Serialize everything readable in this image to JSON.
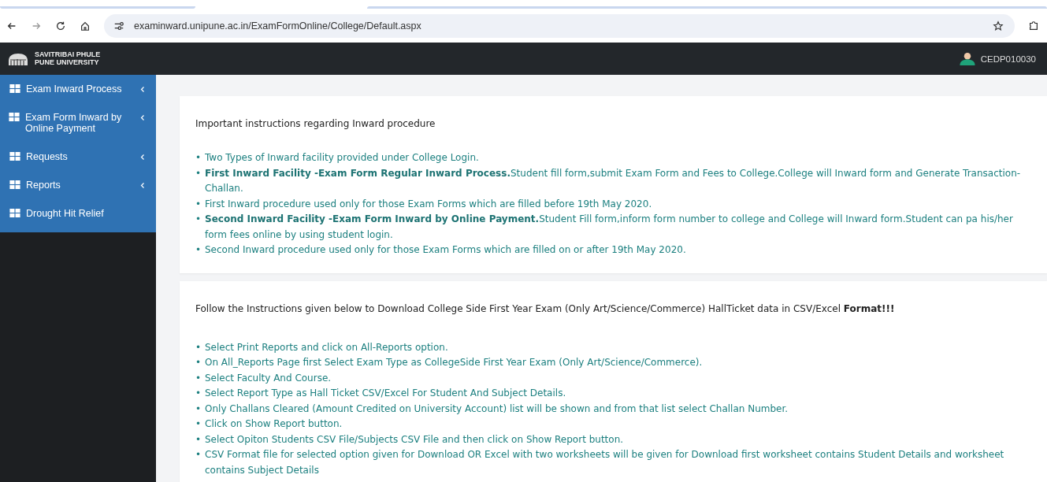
{
  "browser": {
    "url": "examinward.unipune.ac.in/ExamFormOnline/College/Default.aspx"
  },
  "header": {
    "logo_text": [
      "SAVITRIBAI PHULE",
      "PUNE UNIVERSITY"
    ],
    "user": "CEDP010030"
  },
  "sidebar": {
    "items": [
      {
        "label": "Exam Inward Process",
        "has_submenu": true
      },
      {
        "label": "Exam Form Inward by Online Payment",
        "has_submenu": true
      },
      {
        "label": "Requests",
        "has_submenu": true
      },
      {
        "label": "Reports",
        "has_submenu": true
      },
      {
        "label": "Drought Hit Relief",
        "has_submenu": false
      }
    ]
  },
  "panels": [
    {
      "title": "Important instructions regarding Inward procedure",
      "items": [
        {
          "marker": "•",
          "text": "Two Types of Inward facility provided under College Login."
        },
        {
          "marker": "•",
          "text": "**First Inward Facility -Exam Form Regular Inward Process.**Student fill form,submit Exam Form and Fees to College.College will Inward form and Generate Transaction-Challan."
        },
        {
          "marker": "•",
          "text": "First Inward procedure used only for those Exam Forms which are filled before 19th May 2020."
        },
        {
          "marker": "•",
          "text": "**Second Inward Facility -Exam Form Inward by Online Payment.**Student Fill form,inform form number to college and College will Inward form.Student can pa his/her form fees online by using student login."
        },
        {
          "marker": "•",
          "text": "Second Inward procedure used only for those Exam Forms which are filled on or after 19th May 2020."
        }
      ]
    },
    {
      "title": "Follow the Instructions given below to Download College Side First Year Exam (Only Art/Science/Commerce) HallTicket data in CSV/Excel **Format!!!**",
      "items": [
        {
          "marker": "•",
          "text": "Select Print Reports and click on All-Reports option."
        },
        {
          "marker": "•",
          "text": "On All_Reports Page first Select Exam Type as CollegeSide First Year Exam (Only Art/Science/Commerce)."
        },
        {
          "marker": "•",
          "text": "Select Faculty And Course."
        },
        {
          "marker": "•",
          "text": "Select Report Type as Hall Ticket CSV/Excel For Student And Subject Details."
        },
        {
          "marker": "•",
          "text": "Only Challans Cleared (Amount Credited on University Account) list will be shown and from that list select Challan Number."
        },
        {
          "marker": "•",
          "text": "Click on Show Report button."
        },
        {
          "marker": "•",
          "text": "Select Opiton Students CSV File/Subjects CSV File and then click on Show Report button."
        },
        {
          "marker": "•",
          "text": "CSV Format file for selected option given for Download OR Excel with two worksheets will be given for Download first worksheet contains Student Details and worksheet contains Subject Details"
        }
      ]
    }
  ]
}
